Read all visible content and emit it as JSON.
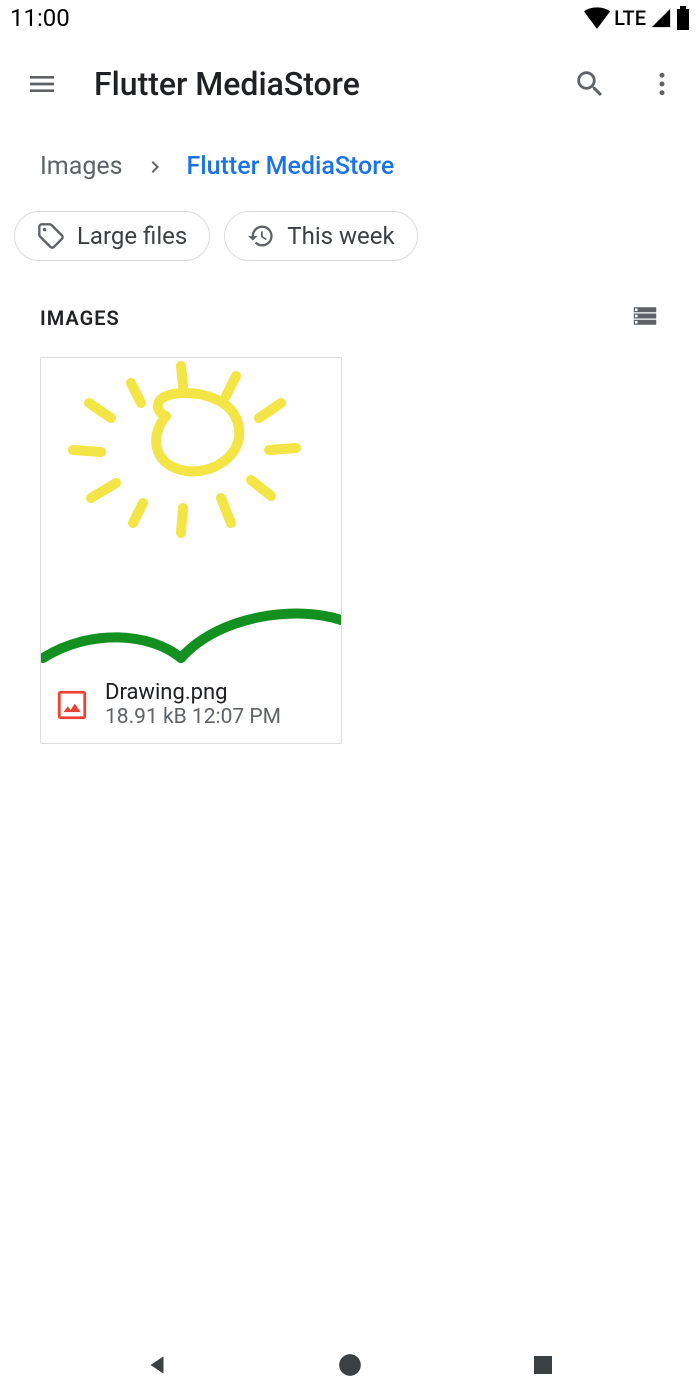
{
  "status": {
    "time": "11:00",
    "network": "LTE"
  },
  "appbar": {
    "title": "Flutter MediaStore"
  },
  "breadcrumb": {
    "root": "Images",
    "current": "Flutter MediaStore"
  },
  "filters": {
    "large_files": "Large files",
    "this_week": "This week"
  },
  "section": {
    "title": "IMAGES"
  },
  "files": [
    {
      "name": "Drawing.png",
      "size": "18.91 kB",
      "time": "12:07 PM"
    }
  ]
}
